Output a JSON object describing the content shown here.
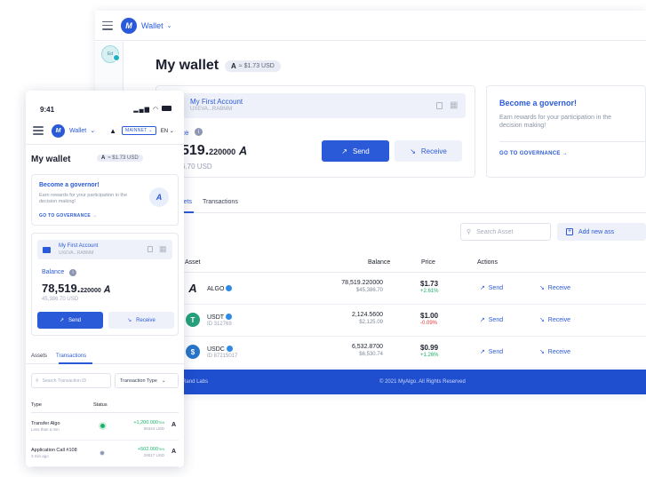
{
  "desktop": {
    "wallet_switch": "Wallet",
    "avatar_text": "Ed",
    "title": "My wallet",
    "algo_symbol": "A",
    "usd_rate": "≈ $1.73 USD",
    "account": {
      "name": "My First Account",
      "address": "UXEVA...RABMM",
      "balance_label": "ce",
      "balance_main": "519.",
      "balance_decimals": "220000",
      "balance_usd": "6.70 USD",
      "send_label": "Send",
      "receive_label": "Receive"
    },
    "governance": {
      "title": "Become a governor!",
      "description": "Earn rewards for your participation in the decision making!",
      "link": "GO TO GOVERNANCE →"
    },
    "tabs": {
      "assets": "Assets",
      "transactions": "Transactions"
    },
    "search_placeholder": "Search Asset",
    "add_asset_label": "Add new ass",
    "table_headers": {
      "asset": "Asset",
      "balance": "Balance",
      "price": "Price",
      "actions": "Actions"
    },
    "assets": [
      {
        "name": "ALGO",
        "id": "",
        "balance": "78,519.220000",
        "balance_usd": "$45,386.70",
        "price": "$1.73",
        "change": "+2.61%",
        "change_dir": "up",
        "send": "Send",
        "receive": "Receive"
      },
      {
        "name": "USDT",
        "id": "ID 312769",
        "balance": "2,124.5600",
        "balance_usd": "$2,125.09",
        "price": "$1.00",
        "change": "-0.09%",
        "change_dir": "down",
        "send": "Send",
        "receive": "Receive"
      },
      {
        "name": "USDC",
        "id": "ID 87215017",
        "balance": "6,532.8700",
        "balance_usd": "$6,530.74",
        "price": "$0.99",
        "change": "+1.26%",
        "change_dir": "up",
        "send": "Send",
        "receive": "Receive"
      }
    ],
    "footer": {
      "left": "© Rand Labs",
      "center": "© 2021 MyAlgo. All Rights Reserved"
    }
  },
  "mobile": {
    "time": "9:41",
    "status_icons": "▐▌ ☷",
    "wallet_switch": "Wallet",
    "network": "MAINNET",
    "language": "EN",
    "title": "My wallet",
    "usd_rate": "≈ $1.73 USD",
    "governance": {
      "title": "Become a governor!",
      "description": "Earn rewards for your participation in the decision making!",
      "link": "GO TO GOVERNANCE →"
    },
    "account": {
      "name": "My First Account",
      "address": "UXEVA...RABMM",
      "balance_label": "Balance",
      "balance_main": "78,519.",
      "balance_decimals": "220000",
      "balance_usd": "45,386.70 USD",
      "send_label": "Send",
      "receive_label": "Receive"
    },
    "tabs": {
      "assets": "Assets",
      "transactions": "Transactions"
    },
    "search_placeholder": "Search Transaction ID",
    "type_select": "Transaction Type",
    "table_headers": {
      "type": "Type",
      "status": "Status"
    },
    "transactions": [
      {
        "type": "Transfer Algo",
        "time": "Less than a min",
        "amount": "+1,200.000",
        "amount_unit": "TKN",
        "usd": "69344 USD"
      },
      {
        "type": "Application Call #108",
        "time": "3 min ago",
        "amount": "+502.000",
        "amount_unit": "TKN",
        "usd": "29017 USD"
      }
    ]
  },
  "colors": {
    "accent": "#2b5ad8",
    "footer": "#1f4fcf",
    "positive": "#1bb36a",
    "negative": "#e23b3b"
  }
}
